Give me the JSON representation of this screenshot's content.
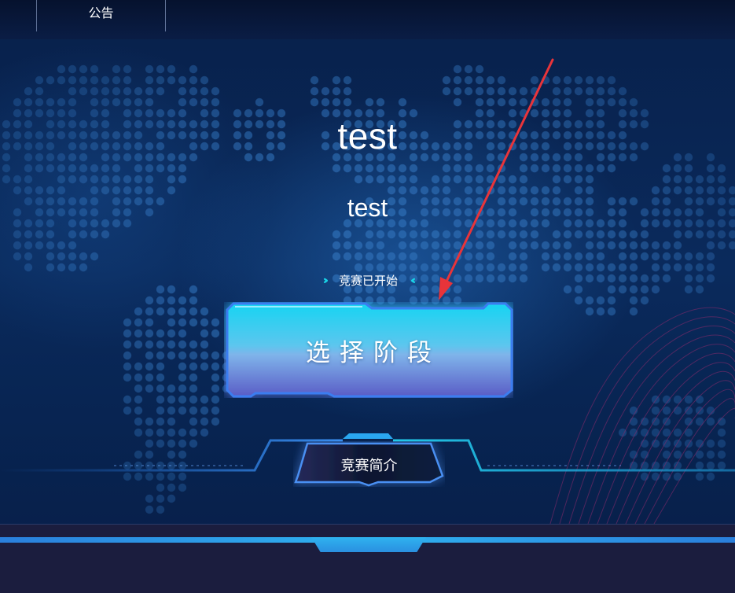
{
  "header": {
    "announcement_tab": "公告"
  },
  "hero": {
    "title": "test",
    "subtitle": "test",
    "status_text": "竞赛已开始",
    "left_chevrons": "›››",
    "right_chevrons": "‹‹‹"
  },
  "actions": {
    "select_stage_label": "选择阶段",
    "intro_label": "竞赛简介"
  },
  "colors": {
    "background": "#061a3c",
    "accent_cyan": "#19d6e8",
    "button_top": "#16d2f0",
    "button_bottom": "#5a5fc8",
    "annotation_arrow": "#e8343a"
  },
  "icons": {
    "left_chevron": "double-right-chevron-icon",
    "right_chevron": "double-left-chevron-icon"
  }
}
